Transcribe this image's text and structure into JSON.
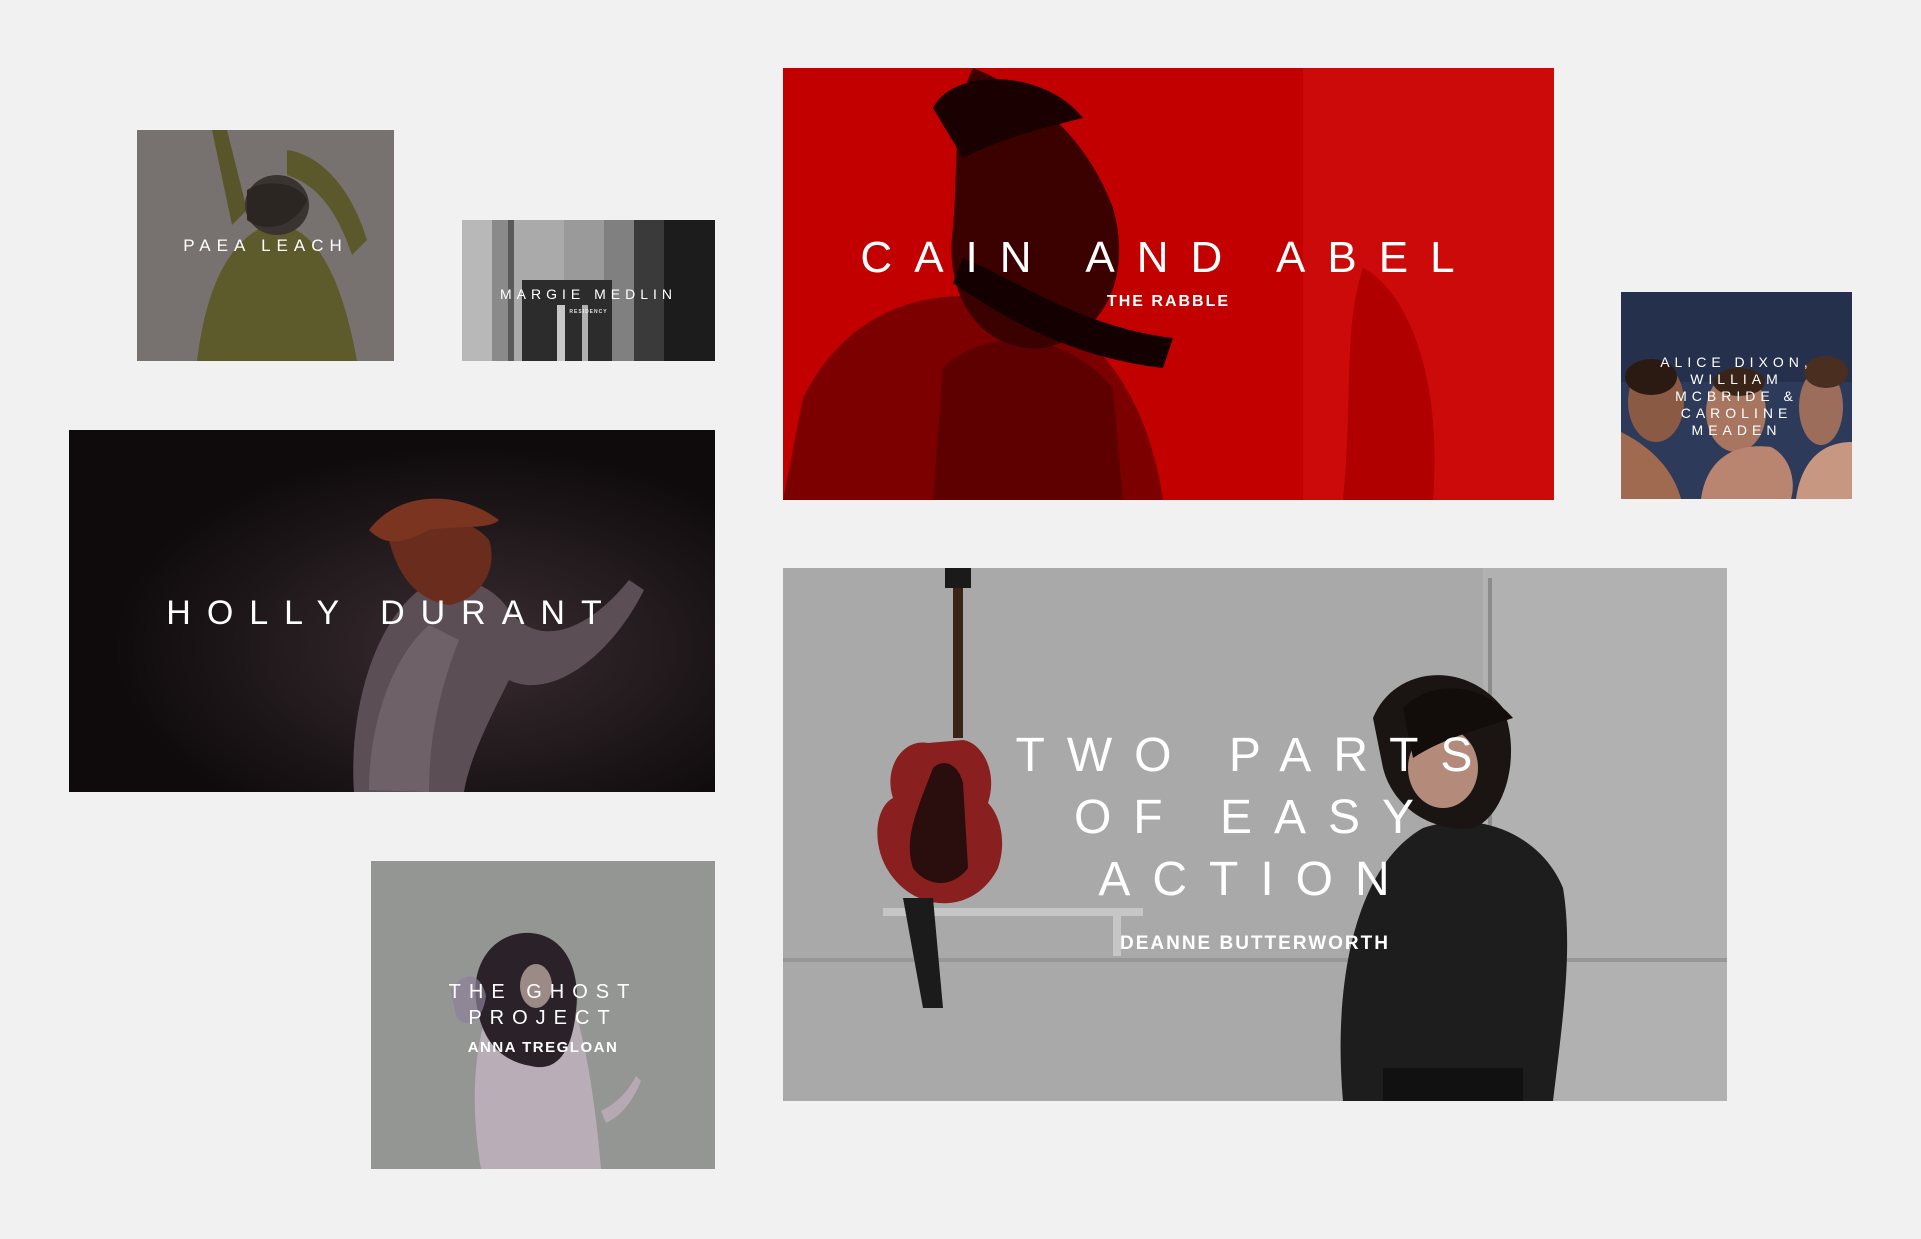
{
  "projects": [
    {
      "id": "paea",
      "title": "PAEA LEACH",
      "subtitle": ""
    },
    {
      "id": "margie",
      "title": "MARGIE MEDLIN",
      "subtitle": "RESIDENCY"
    },
    {
      "id": "cain",
      "title": "CAIN AND ABEL",
      "subtitle": "THE RABBLE"
    },
    {
      "id": "alice",
      "title": "ALICE DIXON, WILLIAM MCBRIDE & CAROLINE MEADEN",
      "subtitle": ""
    },
    {
      "id": "holly",
      "title": "HOLLY DURANT",
      "subtitle": ""
    },
    {
      "id": "two",
      "title": "TWO PARTS OF EASY ACTION",
      "subtitle": "DEANNE BUTTERWORTH"
    },
    {
      "id": "ghost",
      "title": "THE GHOST PROJECT",
      "subtitle": "ANNA TREGLOAN"
    }
  ],
  "colors": {
    "page_background": "#f1f1f1",
    "caption_text": "#ffffff",
    "accent_red": "#c40000"
  }
}
